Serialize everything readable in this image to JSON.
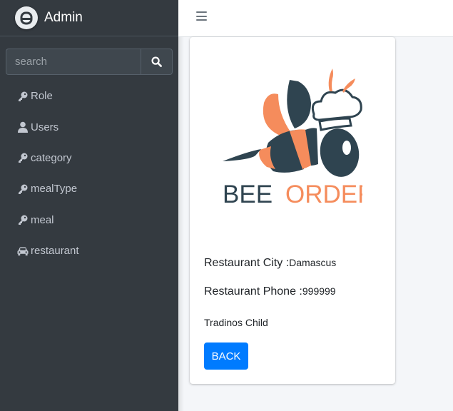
{
  "brand": {
    "title": "Admin"
  },
  "search": {
    "placeholder": "search"
  },
  "sidebar": {
    "items": [
      {
        "label": "Role",
        "icon": "key-icon"
      },
      {
        "label": "Users",
        "icon": "user-icon"
      },
      {
        "label": "category",
        "icon": "key-icon"
      },
      {
        "label": "mealType",
        "icon": "key-icon"
      },
      {
        "label": "meal",
        "icon": "key-icon"
      },
      {
        "label": "restaurant",
        "icon": "car-icon"
      }
    ]
  },
  "logo": {
    "part1": "BEE",
    "part2": "ORDER",
    "dark": "#2f4450",
    "orange": "#f58c5c"
  },
  "details": {
    "city_label": "Restaurant City :",
    "city_value": "Damascus",
    "phone_label": "Restaurant Phone :",
    "phone_value": "999999",
    "company": "Tradinos Child"
  },
  "actions": {
    "back_label": "BACK"
  },
  "colors": {
    "sidebar": "#343a40",
    "accent": "#007bff",
    "background": "#f4f6f9"
  }
}
